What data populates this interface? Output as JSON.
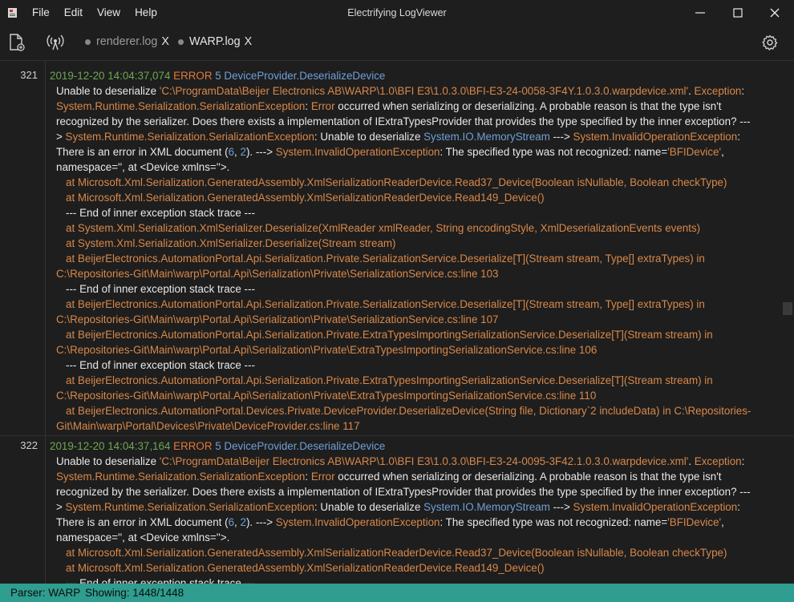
{
  "window": {
    "title": "Electrifying LogViewer",
    "menu": [
      "File",
      "Edit",
      "View",
      "Help"
    ]
  },
  "tabs": [
    {
      "label": "renderer.log",
      "close": "X",
      "active": false
    },
    {
      "label": "WARP.log",
      "close": "X",
      "active": true
    }
  ],
  "entries": [
    {
      "line_no": "321",
      "timestamp": "2019-12-20 14:04:37,074",
      "level": "ERROR",
      "thread": "5",
      "source": "DeviceProvider.DeserializeDevice",
      "lines": [
        [
          [
            "w",
            "Unable to deserialize "
          ],
          [
            "o",
            "'C:\\ProgramData\\Beijer Electronics AB\\WARP\\1.0\\BFI E3\\1.0.3.0\\BFI-E3-24-0058-3F4Y.1.0.3.0.warpdevice.xml'"
          ],
          [
            "w",
            ". "
          ],
          [
            "o",
            "Exception"
          ],
          [
            "w",
            ":"
          ]
        ],
        [
          [
            "o",
            "System.Runtime.Serialization.SerializationException"
          ],
          [
            "w",
            ": "
          ],
          [
            "o",
            "Error"
          ],
          [
            "w",
            " occurred when serializing or deserializing. A probable reason is that the type isn't"
          ]
        ],
        [
          [
            "w",
            "recognized by the serializer. Does there exists a implementation of IExtraTypesProvider that provides the type specified by the inner exception? ---"
          ]
        ],
        [
          [
            "w",
            "> "
          ],
          [
            "o",
            "System.Runtime.Serialization.SerializationException"
          ],
          [
            "w",
            ": Unable to deserialize "
          ],
          [
            "b",
            "System.IO.MemoryStream"
          ],
          [
            "w",
            " ---> "
          ],
          [
            "o",
            "System.InvalidOperationException"
          ],
          [
            "w",
            ":"
          ]
        ],
        [
          [
            "w",
            "There is an error in XML document ("
          ],
          [
            "b",
            "6"
          ],
          [
            "w",
            ", "
          ],
          [
            "b",
            "2"
          ],
          [
            "w",
            "). ---> "
          ],
          [
            "o",
            "System.InvalidOperationException"
          ],
          [
            "w",
            ": The specified type was not recognized: name="
          ],
          [
            "o",
            "'BFIDevice'"
          ],
          [
            "w",
            ","
          ]
        ],
        [
          [
            "w",
            "namespace='', at <Device xmlns=''>."
          ]
        ],
        [
          [
            "ind",
            ""
          ],
          [
            "o",
            "at Microsoft.Xml.Serialization.GeneratedAssembly.XmlSerializationReaderDevice.Read37_Device(Boolean isNullable, Boolean checkType)"
          ]
        ],
        [
          [
            "ind",
            ""
          ],
          [
            "o",
            "at Microsoft.Xml.Serialization.GeneratedAssembly.XmlSerializationReaderDevice.Read149_Device()"
          ]
        ],
        [
          [
            "ind",
            ""
          ],
          [
            "w",
            "--- End of inner exception stack trace ---"
          ]
        ],
        [
          [
            "ind",
            ""
          ],
          [
            "o",
            "at System.Xml.Serialization.XmlSerializer.Deserialize(XmlReader xmlReader, String encodingStyle, XmlDeserializationEvents events)"
          ]
        ],
        [
          [
            "ind",
            ""
          ],
          [
            "o",
            "at System.Xml.Serialization.XmlSerializer.Deserialize(Stream stream)"
          ]
        ],
        [
          [
            "ind",
            ""
          ],
          [
            "o",
            "at BeijerElectronics.AutomationPortal.Api.Serialization.Private.SerializationService.Deserialize[T](Stream stream, Type[] extraTypes) in"
          ]
        ],
        [
          [
            "o",
            "C:\\Repositories-Git\\Main\\warp\\Portal.Api\\Serialization\\Private\\SerializationService.cs:line 103"
          ]
        ],
        [
          [
            "ind",
            ""
          ],
          [
            "w",
            "--- End of inner exception stack trace ---"
          ]
        ],
        [
          [
            "ind",
            ""
          ],
          [
            "o",
            "at BeijerElectronics.AutomationPortal.Api.Serialization.Private.SerializationService.Deserialize[T](Stream stream, Type[] extraTypes) in"
          ]
        ],
        [
          [
            "o",
            "C:\\Repositories-Git\\Main\\warp\\Portal.Api\\Serialization\\Private\\SerializationService.cs:line 107"
          ]
        ],
        [
          [
            "ind",
            ""
          ],
          [
            "o",
            "at BeijerElectronics.AutomationPortal.Api.Serialization.Private.ExtraTypesImportingSerializationService.Deserialize[T](Stream stream) in"
          ]
        ],
        [
          [
            "o",
            "C:\\Repositories-Git\\Main\\warp\\Portal.Api\\Serialization\\Private\\ExtraTypesImportingSerializationService.cs:line 106"
          ]
        ],
        [
          [
            "ind",
            ""
          ],
          [
            "w",
            "--- End of inner exception stack trace ---"
          ]
        ],
        [
          [
            "ind",
            ""
          ],
          [
            "o",
            "at BeijerElectronics.AutomationPortal.Api.Serialization.Private.ExtraTypesImportingSerializationService.Deserialize[T](Stream stream) in"
          ]
        ],
        [
          [
            "o",
            "C:\\Repositories-Git\\Main\\warp\\Portal.Api\\Serialization\\Private\\ExtraTypesImportingSerializationService.cs:line 110"
          ]
        ],
        [
          [
            "ind",
            ""
          ],
          [
            "o",
            "at BeijerElectronics.AutomationPortal.Devices.Private.DeviceProvider.DeserializeDevice(String file, Dictionary`2 includeData) in C:\\Repositories-"
          ]
        ],
        [
          [
            "o",
            "Git\\Main\\warp\\Portal\\Devices\\Private\\DeviceProvider.cs:line 117"
          ]
        ]
      ]
    },
    {
      "line_no": "322",
      "timestamp": "2019-12-20 14:04:37,164",
      "level": "ERROR",
      "thread": "5",
      "source": "DeviceProvider.DeserializeDevice",
      "lines": [
        [
          [
            "w",
            "Unable to deserialize "
          ],
          [
            "o",
            "'C:\\ProgramData\\Beijer Electronics AB\\WARP\\1.0\\BFI E3\\1.0.3.0\\BFI-E3-24-0095-3F42.1.0.3.0.warpdevice.xml'"
          ],
          [
            "w",
            ". "
          ],
          [
            "o",
            "Exception"
          ],
          [
            "w",
            ":"
          ]
        ],
        [
          [
            "o",
            "System.Runtime.Serialization.SerializationException"
          ],
          [
            "w",
            ": "
          ],
          [
            "o",
            "Error"
          ],
          [
            "w",
            " occurred when serializing or deserializing. A probable reason is that the type isn't"
          ]
        ],
        [
          [
            "w",
            "recognized by the serializer. Does there exists a implementation of IExtraTypesProvider that provides the type specified by the inner exception? ---"
          ]
        ],
        [
          [
            "w",
            "> "
          ],
          [
            "o",
            "System.Runtime.Serialization.SerializationException"
          ],
          [
            "w",
            ": Unable to deserialize "
          ],
          [
            "b",
            "System.IO.MemoryStream"
          ],
          [
            "w",
            " ---> "
          ],
          [
            "o",
            "System.InvalidOperationException"
          ],
          [
            "w",
            ":"
          ]
        ],
        [
          [
            "w",
            "There is an error in XML document ("
          ],
          [
            "b",
            "6"
          ],
          [
            "w",
            ", "
          ],
          [
            "b",
            "2"
          ],
          [
            "w",
            "). ---> "
          ],
          [
            "o",
            "System.InvalidOperationException"
          ],
          [
            "w",
            ": The specified type was not recognized: name="
          ],
          [
            "o",
            "'BFIDevice'"
          ],
          [
            "w",
            ","
          ]
        ],
        [
          [
            "w",
            "namespace='', at <Device xmlns=''>."
          ]
        ],
        [
          [
            "ind",
            ""
          ],
          [
            "o",
            "at Microsoft.Xml.Serialization.GeneratedAssembly.XmlSerializationReaderDevice.Read37_Device(Boolean isNullable, Boolean checkType)"
          ]
        ],
        [
          [
            "ind",
            ""
          ],
          [
            "o",
            "at Microsoft.Xml.Serialization.GeneratedAssembly.XmlSerializationReaderDevice.Read149_Device()"
          ]
        ],
        [
          [
            "ind",
            ""
          ],
          [
            "w",
            "--- End of inner exception stack trace ---"
          ]
        ]
      ]
    }
  ],
  "status": {
    "parser_label": "Parser: WARP",
    "showing_label": "Showing: 1448/1448"
  },
  "colors": {
    "accent": "#2f9d8f",
    "timestamp": "#6aa84f",
    "level": "#e07a3a",
    "link": "#6f9fd8",
    "exception": "#d8884a"
  },
  "icons": [
    "app-icon",
    "new-file-icon",
    "antenna-icon",
    "gear-icon",
    "minimize-icon",
    "maximize-icon",
    "close-icon"
  ]
}
